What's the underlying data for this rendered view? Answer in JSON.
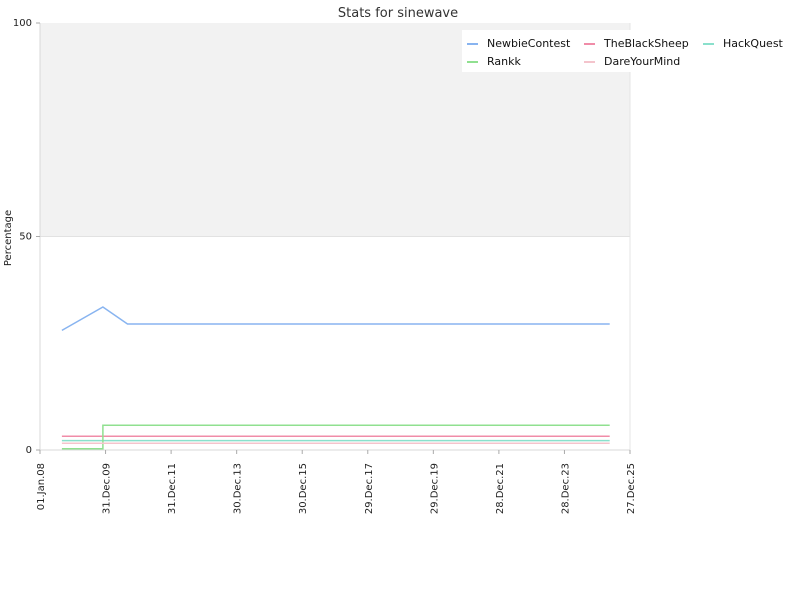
{
  "chart_data": {
    "type": "line",
    "title": "Stats for sinewave",
    "ylabel": "Percentage",
    "xlabel": "",
    "ylim": [
      0,
      100
    ],
    "y_ticks": [
      "0",
      "50",
      "100"
    ],
    "x_ticks": [
      "01.Jan.08",
      "31.Dec.09",
      "31.Dec.11",
      "30.Dec.13",
      "30.Dec.15",
      "29.Dec.17",
      "29.Dec.19",
      "28.Dec.21",
      "28.Dec.23",
      "27.Dec.25"
    ],
    "x_tick_dates": [
      "2008-01-01",
      "2009-12-31",
      "2011-12-31",
      "2013-12-30",
      "2015-12-30",
      "2017-12-29",
      "2019-12-29",
      "2021-12-28",
      "2023-12-28",
      "2025-12-27"
    ],
    "xlim": [
      "2008-01-01",
      "2025-12-27"
    ],
    "shaded_band": [
      50,
      100
    ],
    "grid": false,
    "legend_position": "top-right",
    "series": [
      {
        "name": "NewbieContest",
        "color": "#88b4f0",
        "step": false,
        "points": [
          [
            "2008-09-01",
            28
          ],
          [
            "2009-12-01",
            33.5
          ],
          [
            "2010-09-01",
            29.5
          ],
          [
            "2025-05-15",
            29.5
          ]
        ]
      },
      {
        "name": "TheBlackSheep",
        "color": "#f08ca8",
        "step": true,
        "points": [
          [
            "2008-09-01",
            3.2
          ],
          [
            "2025-05-15",
            3.2
          ]
        ]
      },
      {
        "name": "HackQuest",
        "color": "#8ae0cc",
        "step": true,
        "points": [
          [
            "2008-09-01",
            2.2
          ],
          [
            "2025-05-15",
            2.2
          ]
        ]
      },
      {
        "name": "Rankk",
        "color": "#90e090",
        "step": true,
        "points": [
          [
            "2008-09-01",
            0.3
          ],
          [
            "2009-12-01",
            0.3
          ],
          [
            "2009-12-01",
            5.8
          ],
          [
            "2025-05-15",
            5.8
          ]
        ]
      },
      {
        "name": "DareYourMind",
        "color": "#f4c4cc",
        "step": true,
        "points": [
          [
            "2008-09-01",
            1.6
          ],
          [
            "2025-05-15",
            1.6
          ]
        ]
      }
    ]
  }
}
